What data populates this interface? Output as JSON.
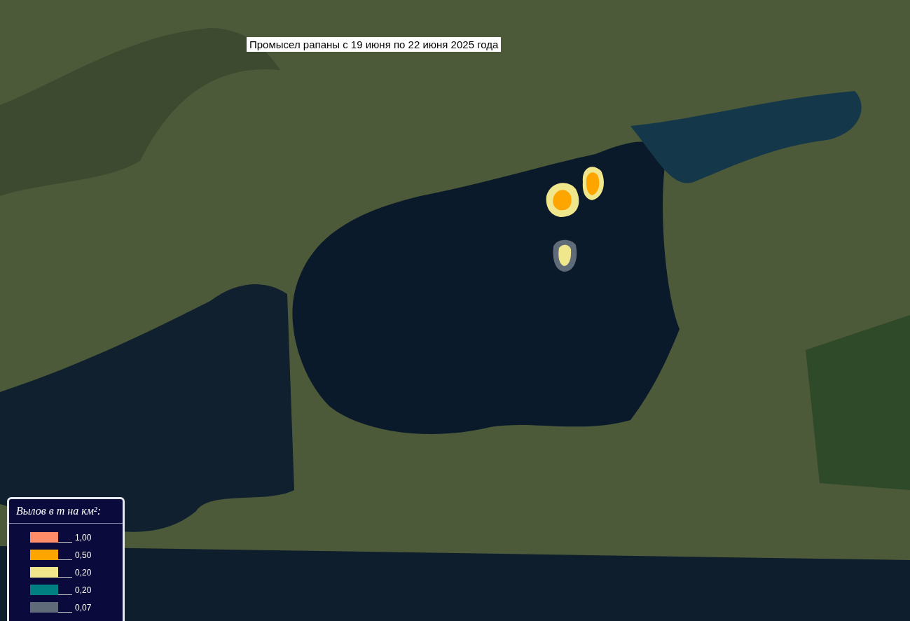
{
  "map": {
    "title": "Промысел рапаны с 19 июня по 22 июня 2025 года"
  },
  "legend": {
    "title": "Вылов в т на км²:",
    "items": [
      {
        "label": "1,00",
        "color": "#ff8c69"
      },
      {
        "label": "0,50",
        "color": "#ffa500"
      },
      {
        "label": "0,20",
        "color": "#f0e68c"
      },
      {
        "label": "0,20",
        "color": "#008080"
      },
      {
        "label": "0,07",
        "color": "#5f6b78"
      }
    ]
  }
}
